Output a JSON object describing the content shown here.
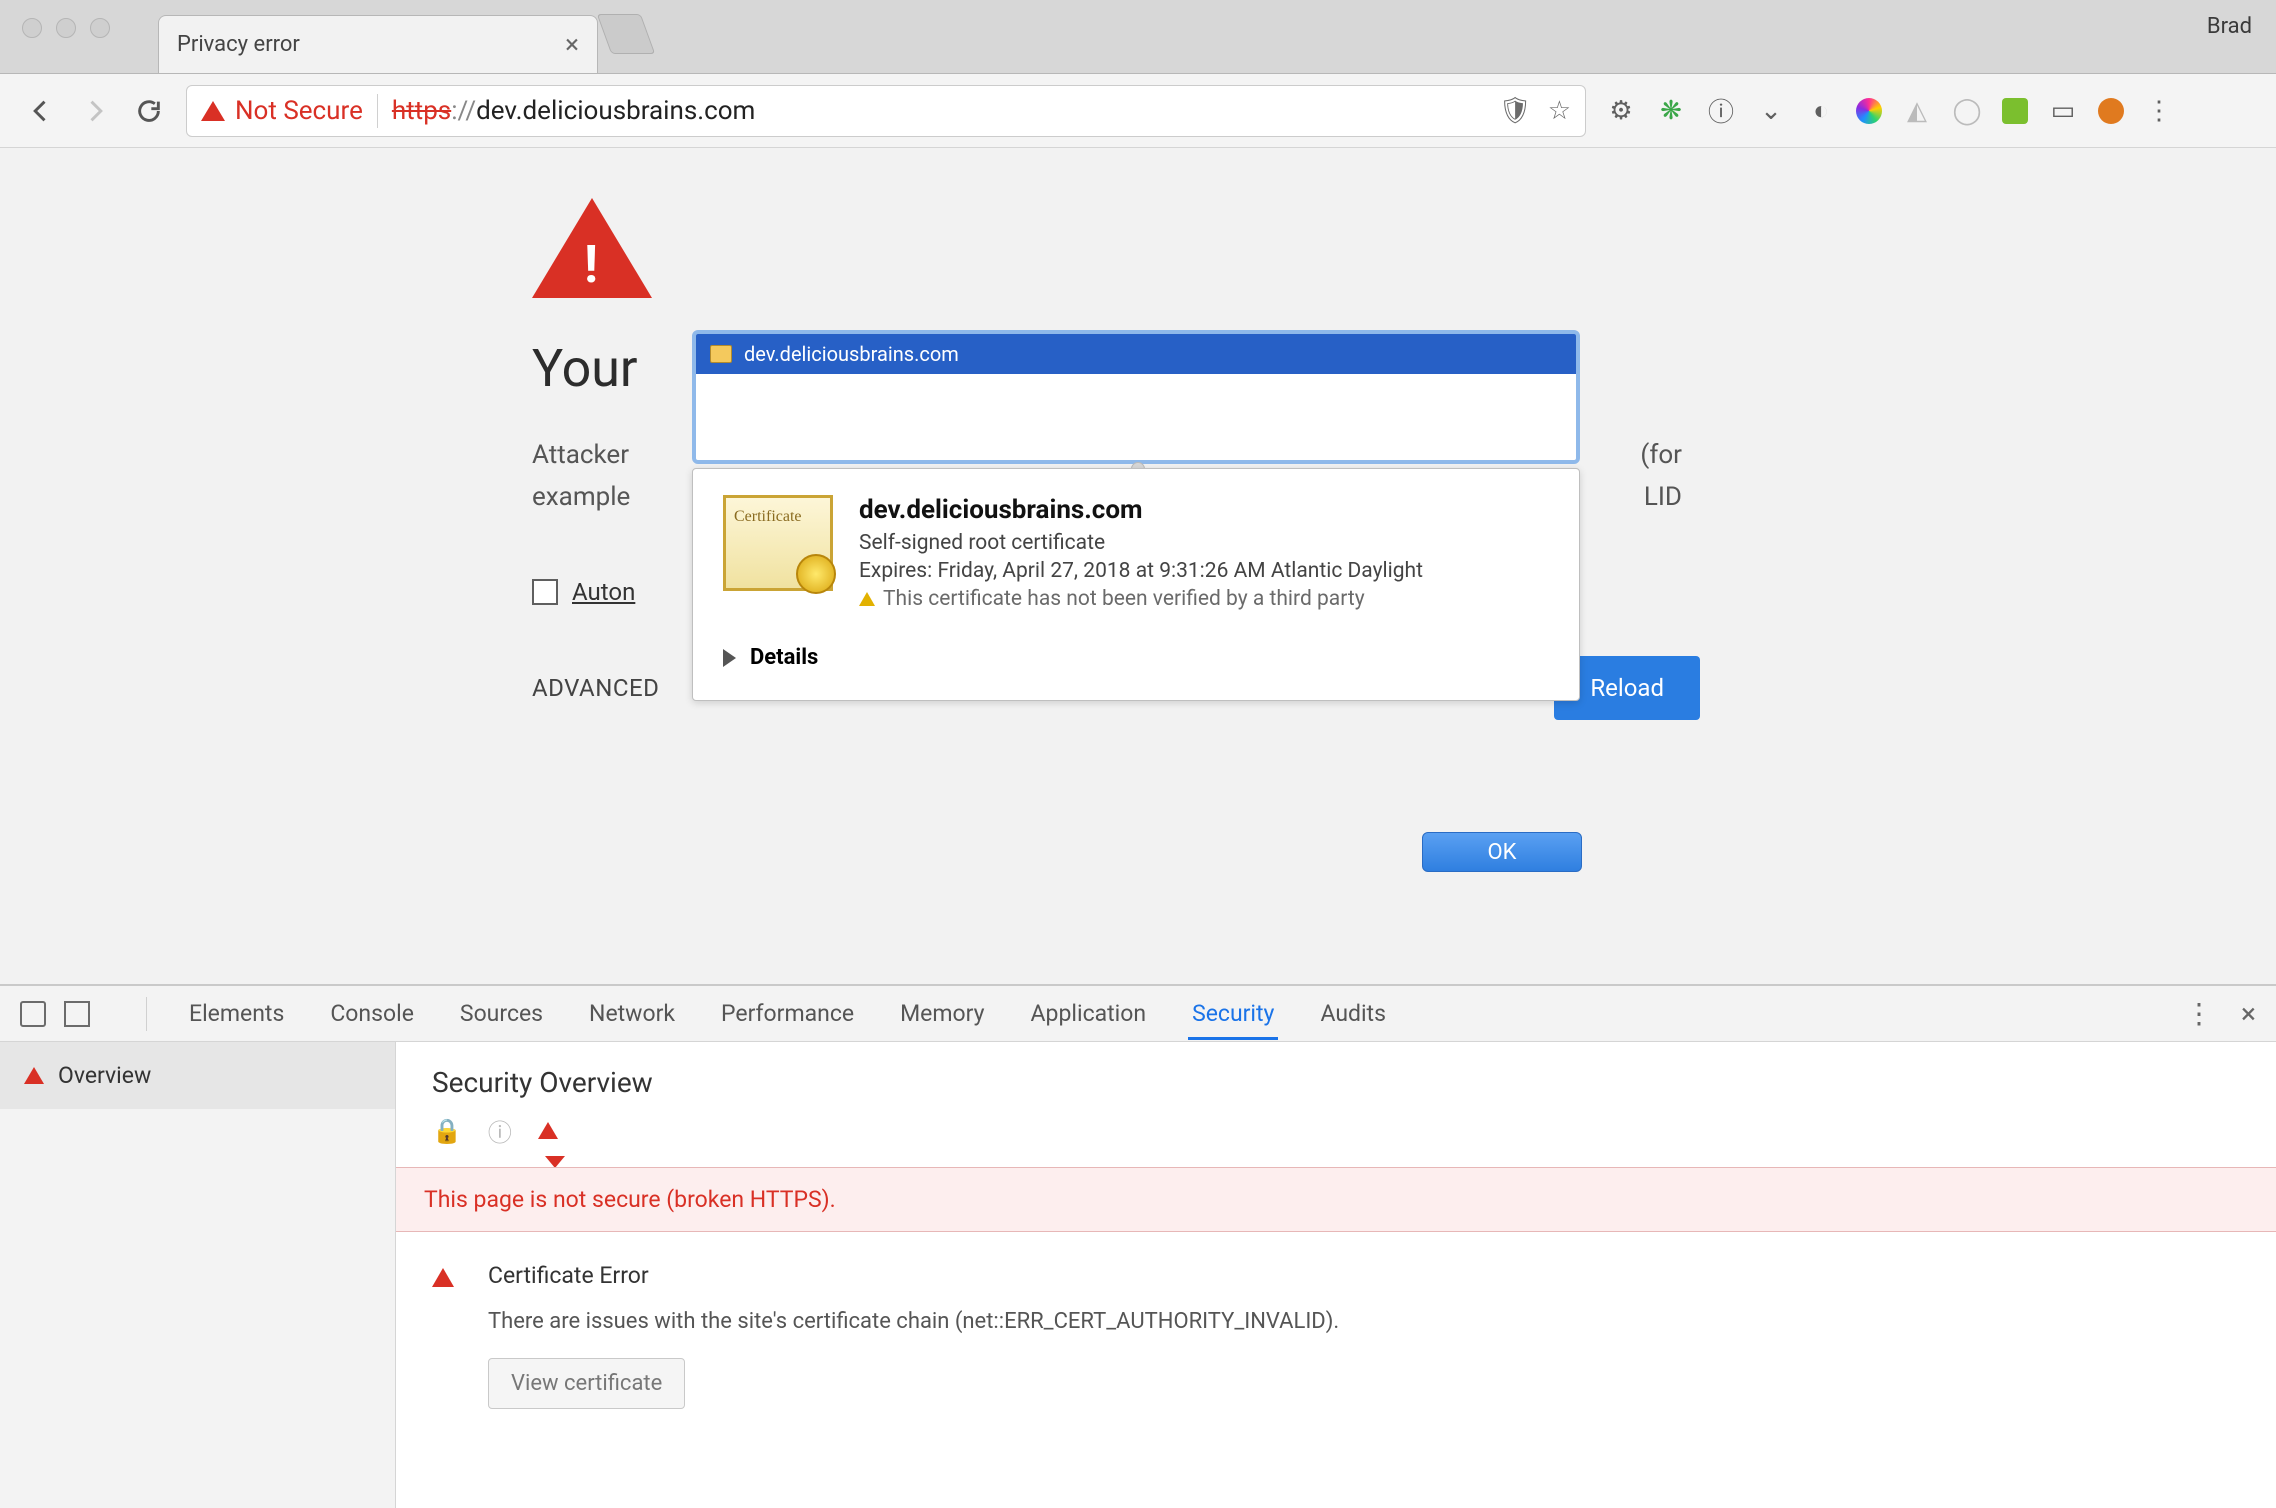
{
  "window": {
    "profile": "Brad"
  },
  "tab": {
    "title": "Privacy error"
  },
  "security_chip": "Not Secure",
  "url": {
    "scheme": "https",
    "sep": "://",
    "host_path": "dev.deliciousbrains.com"
  },
  "error_page": {
    "heading_visible_left": "Your ",
    "body_visible_left_1": "Attacker",
    "body_visible_left_2": "example",
    "body_visible_right_1": " (for",
    "body_visible_right_2": "LID",
    "auto_report_label": "Auton",
    "advanced": "ADVANCED",
    "reload": "Reload"
  },
  "cert_bar": {
    "domain": "dev.deliciousbrains.com"
  },
  "cert_popup": {
    "title": "dev.deliciousbrains.com",
    "sub": "Self-signed root certificate",
    "expires": "Expires: Friday, April 27, 2018 at 9:31:26 AM Atlantic Daylight",
    "warning": "This certificate has not been verified by a third party",
    "details": "Details",
    "ok": "OK"
  },
  "devtools": {
    "tabs": [
      "Elements",
      "Console",
      "Sources",
      "Network",
      "Performance",
      "Memory",
      "Application",
      "Security",
      "Audits"
    ],
    "active_tab": "Security",
    "side_item": "Overview",
    "overview_heading": "Security Overview",
    "banner": "This page is not secure (broken HTTPS).",
    "cert_error_title": "Certificate Error",
    "cert_error_body": "There are issues with the site's certificate chain (net::ERR_CERT_AUTHORITY_INVALID).",
    "view_certificate": "View certificate"
  }
}
